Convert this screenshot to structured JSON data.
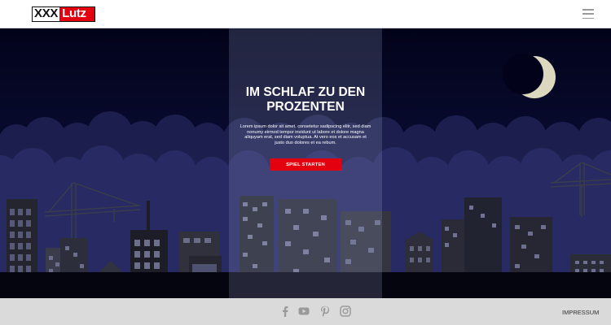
{
  "header": {
    "logo": {
      "part1": "XXX",
      "part2": "Lutz"
    },
    "menu_icon": "hamburger-menu-icon"
  },
  "hero": {
    "title": "IM SCHLAF ZU DEN PROZENTEN",
    "text": "Lorem ipsum dolor sit amet, consetetur sadipscing elitr, sed diam nonumy eirmod tempor invidunt ut labore et dolore magna aliquyam erat, sed diam voluptua. At vero eos et accusam et justo duo dolores et ea rebum.",
    "button_label": "SPIEL STARTEN"
  },
  "footer": {
    "social_icons": [
      "facebook-icon",
      "youtube-icon",
      "pinterest-icon",
      "instagram-icon"
    ],
    "impressum": "IMPRESSUM"
  },
  "colors": {
    "brand_red": "#e3000f",
    "night_sky": "#03041f",
    "cloud": "#26295a",
    "footer_bg": "#dadada"
  }
}
